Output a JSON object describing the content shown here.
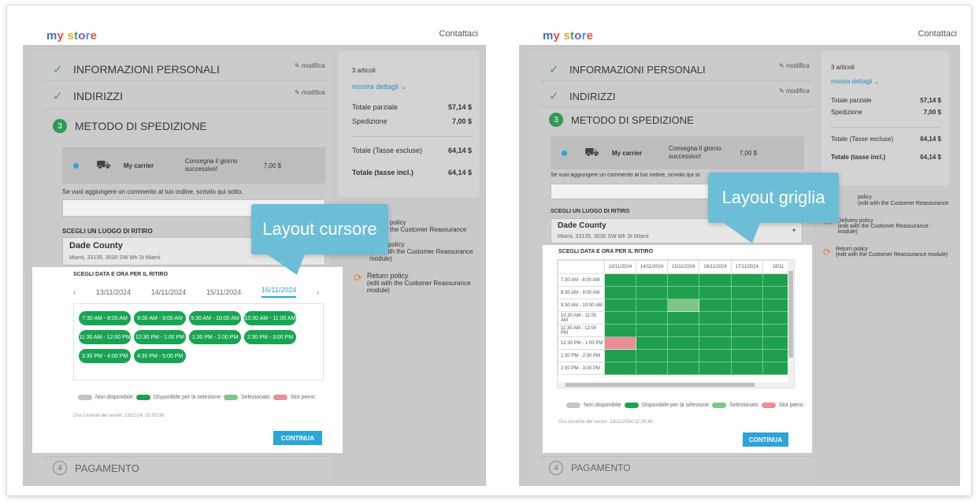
{
  "logo": "my store",
  "contact": "Contattaci",
  "steps": {
    "personal": "INFORMAZIONI PERSONALI",
    "addresses": "INDIRIZZI",
    "shipping_num": "3",
    "shipping": "METODO DI SPEDIZIONE",
    "payment_num": "4",
    "payment": "PAGAMENTO",
    "edit": "modifica"
  },
  "carrier": {
    "name": "My carrier",
    "delay": "Consegna il giorno successivo!",
    "price": "7,00 $"
  },
  "comment_label": "Se vuoi aggiungere un commento al tuo ordine, scrivilo qui sotto.",
  "pickup": {
    "label": "SCEGLI UN LUOGO DI RITIRO",
    "store": "Dade County",
    "address": "Miami, 33135, 3030 SW 8th St Miami"
  },
  "datetime_label": "SCEGLI DATA E ORA PER IL RITIRO",
  "dates": [
    "13/11/2024",
    "14/11/2024",
    "15/11/2024",
    "16/11/2024"
  ],
  "slots": [
    "7:30 AM - 8:00 AM",
    "8:30 AM - 9:00 AM",
    "9:30 AM - 10:00 AM",
    "10:30 AM - 11:00 AM",
    "11:30 AM - 12:00 PM",
    "12:30 PM - 1:00 PM",
    "1:30 PM - 2:00 PM",
    "2:30 PM - 3:00 PM",
    "3:30 PM - 4:00 PM",
    "4:30 PM - 5:00 PM"
  ],
  "grid_dates": [
    "13/11/2024",
    "14/11/2024",
    "15/11/2024",
    "16/11/2024",
    "17/11/2024",
    "18/11"
  ],
  "grid_times": [
    "7:30 AM - 8:00 AM",
    "8:30 AM - 9:00 AM",
    "9:30 AM - 10:00 AM",
    "10:30 AM - 11:00 AM",
    "11:30 AM - 12:00 PM",
    "12:30 PM - 1:00 PM",
    "1:30 PM - 2:00 PM",
    "2:30 PM - 3:00 PM"
  ],
  "legend": {
    "unavailable": "Non disponibile",
    "available": "Disponibile per la selezione",
    "selected": "Selezionato",
    "full": "Slot pieno"
  },
  "server_time_left": "Ora corrente del server: 13/11/24, 02:05:08",
  "server_time_right": "Ora corrente del server: 13/11/2024 02:05:49",
  "continue": "CONTINUA",
  "summary": {
    "count": "3 articoli",
    "details": "mostra dettagli",
    "subtotal_label": "Totale parziale",
    "subtotal": "57,14 $",
    "shipping_label": "Spedizione",
    "shipping": "7,00 $",
    "tax_excl_label": "Totale (Tasse escluse)",
    "tax_excl": "64,14 $",
    "tax_incl_label": "Totale (tasse incl.)",
    "tax_incl": "64,14 $"
  },
  "policies": {
    "security": "policy",
    "security_sub": "(edit with the Customer Reassurance",
    "delivery": "Delivery policy",
    "delivery_sub": "(edit with the Customer Reassurance module)",
    "return": "Return policy",
    "return_sub": "(edit with the Customer Reassurance module)",
    "security_left_tail": "policy",
    "security_left_sub": "the Customer Reassurance",
    "delivery_left": "policy",
    "delivery_left_sub": "(edit with the Customer Reassurance module)"
  },
  "callouts": {
    "slider": "Layout cursore",
    "grid": "Layout griglia"
  },
  "colors": {
    "green": "#18a553",
    "light_green": "#7bc783",
    "full": "#e78f96",
    "unavailable": "#c4c4c4",
    "accent": "#2ba5d6",
    "callout": "#6cbed7"
  }
}
